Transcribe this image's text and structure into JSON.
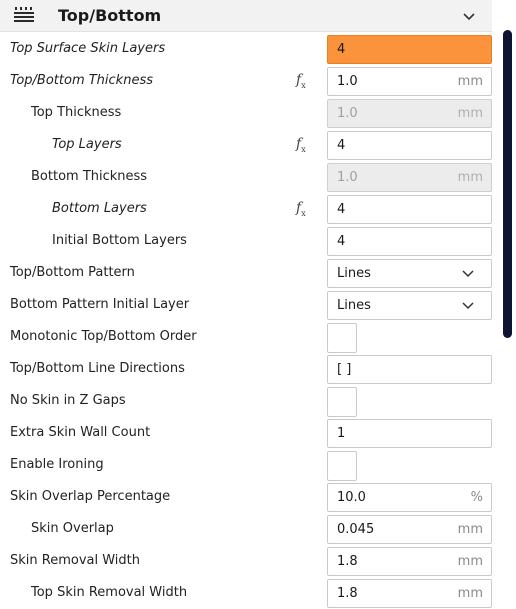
{
  "category": {
    "title": "Top/Bottom",
    "icon": "top-bottom-layers-icon"
  },
  "colors": {
    "highlight": "#fb923c",
    "scrollbar": "#0f1230"
  },
  "settings": [
    {
      "label": "Top Surface Skin Layers",
      "value": "4",
      "unit": ""
    },
    {
      "label": "Top/Bottom Thickness",
      "value": "1.0",
      "unit": "mm"
    },
    {
      "label": "Top Thickness",
      "value": "1.0",
      "unit": "mm"
    },
    {
      "label": "Top Layers",
      "value": "4",
      "unit": ""
    },
    {
      "label": "Bottom Thickness",
      "value": "1.0",
      "unit": "mm"
    },
    {
      "label": "Bottom Layers",
      "value": "4",
      "unit": ""
    },
    {
      "label": "Initial Bottom Layers",
      "value": "4",
      "unit": ""
    },
    {
      "label": "Top/Bottom Pattern",
      "value": "Lines",
      "unit": ""
    },
    {
      "label": "Bottom Pattern Initial Layer",
      "value": "Lines",
      "unit": ""
    },
    {
      "label": "Monotonic Top/Bottom Order",
      "value": "",
      "unit": ""
    },
    {
      "label": "Top/Bottom Line Directions",
      "value": "[ ]",
      "unit": ""
    },
    {
      "label": "No Skin in Z Gaps",
      "value": "",
      "unit": ""
    },
    {
      "label": "Extra Skin Wall Count",
      "value": "1",
      "unit": ""
    },
    {
      "label": "Enable Ironing",
      "value": "",
      "unit": ""
    },
    {
      "label": "Skin Overlap Percentage",
      "value": "10.0",
      "unit": "%"
    },
    {
      "label": "Skin Overlap",
      "value": "0.045",
      "unit": "mm"
    },
    {
      "label": "Skin Removal Width",
      "value": "1.8",
      "unit": "mm"
    },
    {
      "label": "Top Skin Removal Width",
      "value": "1.8",
      "unit": "mm"
    }
  ]
}
